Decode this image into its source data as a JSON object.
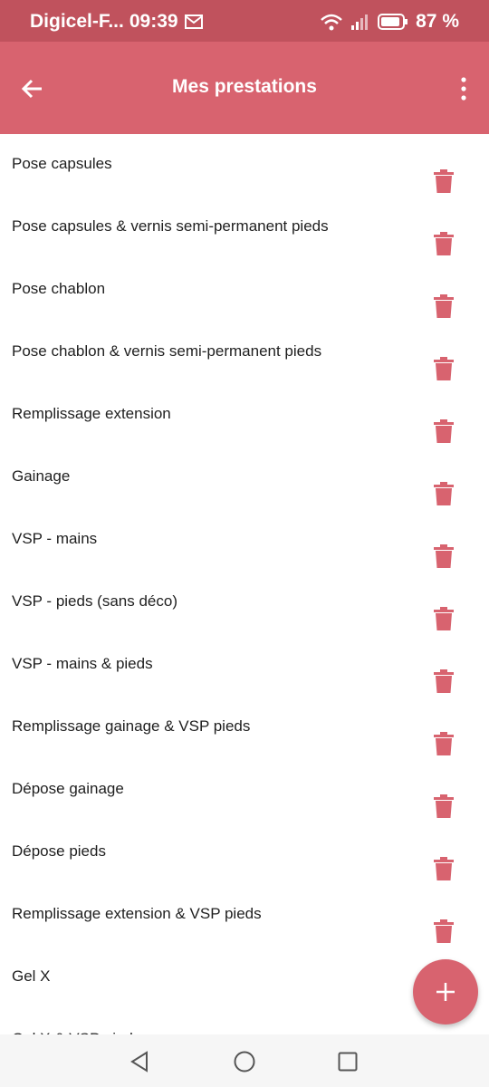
{
  "status_bar": {
    "carrier": "Digicel-F...",
    "time": "09:39",
    "battery": "87 %",
    "icons": [
      "mail-icon",
      "wifi-icon",
      "signal-icon",
      "battery-icon"
    ]
  },
  "app_bar": {
    "title": "Mes prestations",
    "back_icon": "arrow-left-icon",
    "menu_icon": "more-vertical-icon"
  },
  "services": [
    {
      "label": "Pose capsules"
    },
    {
      "label": "Pose capsules & vernis semi-permanent pieds"
    },
    {
      "label": "Pose chablon"
    },
    {
      "label": "Pose chablon & vernis semi-permanent pieds"
    },
    {
      "label": "Remplissage extension"
    },
    {
      "label": "Gainage"
    },
    {
      "label": "VSP - mains"
    },
    {
      "label": "VSP - pieds (sans déco)"
    },
    {
      "label": "VSP - mains & pieds"
    },
    {
      "label": "Remplissage gainage & VSP pieds"
    },
    {
      "label": "Dépose gainage"
    },
    {
      "label": "Dépose pieds"
    },
    {
      "label": "Remplissage extension & VSP pieds"
    },
    {
      "label": "Gel X"
    },
    {
      "label": "Gel X & VSP pieds"
    }
  ],
  "fab": {
    "icon": "plus-icon"
  },
  "nav": {
    "icons": [
      "back-triangle-icon",
      "home-circle-icon",
      "recents-square-icon"
    ]
  },
  "colors": {
    "status_bar": "#c0525d",
    "app_bar": "#d8636f",
    "accent": "#d8636f",
    "text": "#1f1f1f"
  }
}
